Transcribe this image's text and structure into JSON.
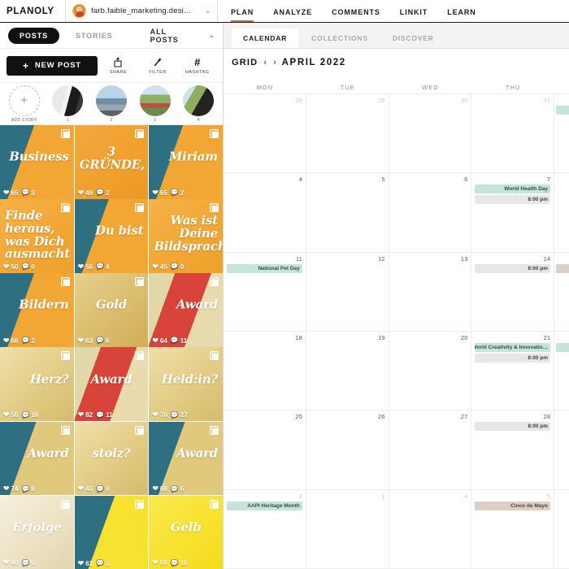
{
  "topbar": {
    "brand": "PLANOLY",
    "account_name": "farb.faible_marketing.desi…",
    "account_caret": "⌄",
    "nav": [
      {
        "label": "PLAN",
        "active": true
      },
      {
        "label": "ANALYZE",
        "active": false
      },
      {
        "label": "COMMENTS",
        "active": false
      },
      {
        "label": "LINKIT",
        "active": false
      },
      {
        "label": "LEARN",
        "active": false
      }
    ]
  },
  "left": {
    "tabs": [
      {
        "label": "POSTS",
        "active": true
      },
      {
        "label": "STORIES",
        "active": false
      }
    ],
    "filter_label": "ALL POSTS",
    "filter_caret": "⌄",
    "new_post_label": "NEW POST",
    "new_post_plus": "+",
    "tools": [
      {
        "label": "SHARE",
        "icon": "share-icon"
      },
      {
        "label": "FILTER",
        "icon": "magic-wand-icon"
      },
      {
        "label": "HASHTAG",
        "icon": "hashtag-icon",
        "glyph": "#"
      }
    ],
    "stories": [
      {
        "label": "ADD STORY",
        "kind": "add",
        "glyph": "+"
      },
      {
        "label": "1",
        "kind": "s1"
      },
      {
        "label": "2",
        "kind": "s2"
      },
      {
        "label": "3",
        "kind": "s3"
      },
      {
        "label": "4",
        "kind": "s4"
      }
    ],
    "posts": [
      {
        "caption": "Business",
        "likes": "65",
        "comments": "3",
        "bg": "bg-person-o",
        "align": "t-right"
      },
      {
        "caption": "3 GRÜNDE,",
        "likes": "49",
        "comments": "2",
        "bg": "bg-orange",
        "align": "t-center"
      },
      {
        "caption": "Miriam",
        "likes": "65",
        "comments": "2",
        "bg": "bg-person-o",
        "align": "t-right"
      },
      {
        "caption": "Finde heraus, was Dich ausmacht",
        "likes": "50",
        "comments": "0",
        "bg": "bg-orange2",
        "align": "t-left"
      },
      {
        "caption": "Du bist",
        "likes": "56",
        "comments": "4",
        "bg": "bg-person-o",
        "align": "t-right"
      },
      {
        "caption": "Was ist Deine Bildsprache?",
        "likes": "45",
        "comments": "0",
        "bg": "bg-orange2",
        "align": "t-right"
      },
      {
        "caption": "Bildern",
        "likes": "66",
        "comments": "2",
        "bg": "bg-person-o",
        "align": "t-right"
      },
      {
        "caption": "Gold",
        "likes": "63",
        "comments": "6",
        "bg": "bg-gold",
        "align": "t-center"
      },
      {
        "caption": "Award",
        "likes": "64",
        "comments": "11",
        "bg": "bg-person-r",
        "align": "t-right"
      },
      {
        "caption": "Herz?",
        "likes": "56",
        "comments": "16",
        "bg": "bg-gold2",
        "align": "t-right"
      },
      {
        "caption": "Award",
        "likes": "82",
        "comments": "11",
        "bg": "bg-person-r",
        "align": "t-center"
      },
      {
        "caption": "Held:in?",
        "likes": "70",
        "comments": "27",
        "bg": "bg-gold2",
        "align": "t-right"
      },
      {
        "caption": "Award",
        "likes": "74",
        "comments": "8",
        "bg": "bg-person-g",
        "align": "t-right"
      },
      {
        "caption": "stolz?",
        "likes": "43",
        "comments": "0",
        "bg": "bg-gold2",
        "align": "t-center"
      },
      {
        "caption": "Award",
        "likes": "68",
        "comments": "6",
        "bg": "bg-person-g",
        "align": "t-right"
      },
      {
        "caption": "Erfolge",
        "likes": "40",
        "comments": "0",
        "bg": "bg-cream",
        "align": "t-center"
      },
      {
        "caption": "",
        "likes": "61",
        "comments": "3",
        "bg": "bg-person-y",
        "align": "t-center"
      },
      {
        "caption": "Gelb",
        "likes": "60",
        "comments": "16",
        "bg": "bg-yellow",
        "align": "t-center"
      }
    ]
  },
  "right": {
    "subtabs": [
      {
        "label": "CALENDAR",
        "active": true
      },
      {
        "label": "COLLECTIONS",
        "active": false
      },
      {
        "label": "DISCOVER",
        "active": false
      }
    ],
    "calendar": {
      "grid_label": "GRID",
      "prev_arrow": "‹",
      "next_arrow": "›",
      "month": "APRIL 2022",
      "daynames": [
        "MON",
        "TUE",
        "WED",
        "THU"
      ],
      "weeks": [
        {
          "cells": [
            {
              "day": "28",
              "out": true,
              "events": []
            },
            {
              "day": "29",
              "out": true,
              "events": []
            },
            {
              "day": "30",
              "out": true,
              "events": []
            },
            {
              "day": "31",
              "out": true,
              "events": []
            }
          ],
          "edge_events": [
            {
              "label": "",
              "style": "mint"
            }
          ]
        },
        {
          "cells": [
            {
              "day": "4",
              "out": false,
              "events": []
            },
            {
              "day": "5",
              "out": false,
              "events": []
            },
            {
              "day": "6",
              "out": false,
              "events": []
            },
            {
              "day": "7",
              "out": false,
              "events": [
                {
                  "label": "World Health Day",
                  "style": "mint"
                },
                {
                  "label": "8:00 pm",
                  "style": "grey"
                }
              ]
            }
          ],
          "edge_events": []
        },
        {
          "cells": [
            {
              "day": "11",
              "out": false,
              "events": [
                {
                  "label": "National Pet Day",
                  "style": "mint"
                }
              ]
            },
            {
              "day": "12",
              "out": false,
              "events": []
            },
            {
              "day": "13",
              "out": false,
              "events": []
            },
            {
              "day": "14",
              "out": false,
              "events": [
                {
                  "label": "8:00 pm",
                  "style": "grey"
                }
              ]
            }
          ],
          "edge_events": [
            {
              "label": "",
              "style": "tan"
            }
          ]
        },
        {
          "cells": [
            {
              "day": "18",
              "out": false,
              "events": []
            },
            {
              "day": "19",
              "out": false,
              "events": []
            },
            {
              "day": "20",
              "out": false,
              "events": []
            },
            {
              "day": "21",
              "out": false,
              "events": [
                {
                  "label": "World Creativity & Innovatio…",
                  "style": "mint"
                },
                {
                  "label": "8:00 pm",
                  "style": "grey"
                }
              ]
            }
          ],
          "edge_events": [
            {
              "label": "",
              "style": "mint"
            }
          ]
        },
        {
          "cells": [
            {
              "day": "25",
              "out": false,
              "events": []
            },
            {
              "day": "26",
              "out": false,
              "events": []
            },
            {
              "day": "27",
              "out": false,
              "events": []
            },
            {
              "day": "28",
              "out": false,
              "events": [
                {
                  "label": "8:00 pm",
                  "style": "grey"
                }
              ]
            }
          ],
          "edge_events": []
        },
        {
          "cells": [
            {
              "day": "2",
              "out": true,
              "events": [
                {
                  "label": "AAPI Heritage Month",
                  "style": "mint"
                }
              ]
            },
            {
              "day": "3",
              "out": true,
              "events": []
            },
            {
              "day": "4",
              "out": true,
              "events": []
            },
            {
              "day": "5",
              "out": true,
              "events": [
                {
                  "label": "Cinco de Mayo",
                  "style": "tan"
                }
              ]
            }
          ],
          "edge_events": []
        }
      ]
    }
  }
}
